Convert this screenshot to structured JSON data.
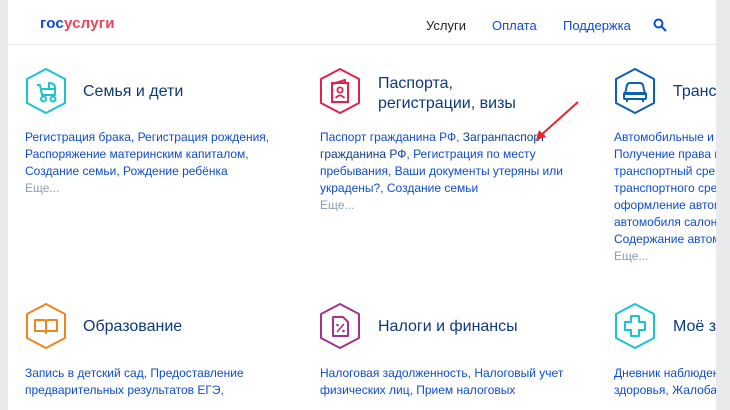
{
  "header": {
    "logo_part1": "гос",
    "logo_part2": "услуги",
    "nav": [
      "Услуги",
      "Оплата",
      "Поддержка"
    ]
  },
  "colors": {
    "brand": "#0d4cd3",
    "family": "#19c3d0",
    "passport": "#e0234a",
    "transport": "#0d5fb3",
    "education": "#f0841f",
    "taxes": "#a8328a",
    "health": "#19c3d0"
  },
  "cards": {
    "family": {
      "icon": "stroller-icon",
      "title": "Семья и дети",
      "links": [
        "Регистрация брака",
        "Регистрация рождения",
        "Распоряжение материнским капиталом",
        "Создание семьи",
        "Рождение ребёнка"
      ],
      "more": "Еще..."
    },
    "passport": {
      "icon": "passport-icon",
      "title_line1": "Паспорта,",
      "title_line2": "регистрации, визы",
      "links": [
        "Паспорт гражданина РФ",
        "Загранпаспорт гражданина РФ",
        "Регистрация по месту пребывания",
        "Ваши документы утеряны или украдены?",
        "Создание семьи"
      ],
      "more": "Еще..."
    },
    "transport": {
      "icon": "car-icon",
      "title": "Транс",
      "links": [
        "Автомобильные и",
        "Получение права н",
        "транспортный сре",
        "транспортного сре",
        "оформление автом",
        "автомобиля салон",
        "Содержание автом"
      ],
      "more": "Еще..."
    },
    "education": {
      "icon": "book-icon",
      "title": "Образование",
      "links": [
        "Запись в детский сад",
        "Предоставление",
        "предварительных результатов ЕГЭ,"
      ]
    },
    "taxes": {
      "icon": "tax-document-icon",
      "title": "Налоги и финансы",
      "links": [
        "Налоговая задолженность",
        "Налоговый учет",
        "физических лиц",
        "Прием налоговых"
      ]
    },
    "health": {
      "icon": "medical-cross-icon",
      "title": "Моё з",
      "links": [
        "Дневник наблюден",
        "здоровья",
        "Жалоба"
      ]
    }
  }
}
